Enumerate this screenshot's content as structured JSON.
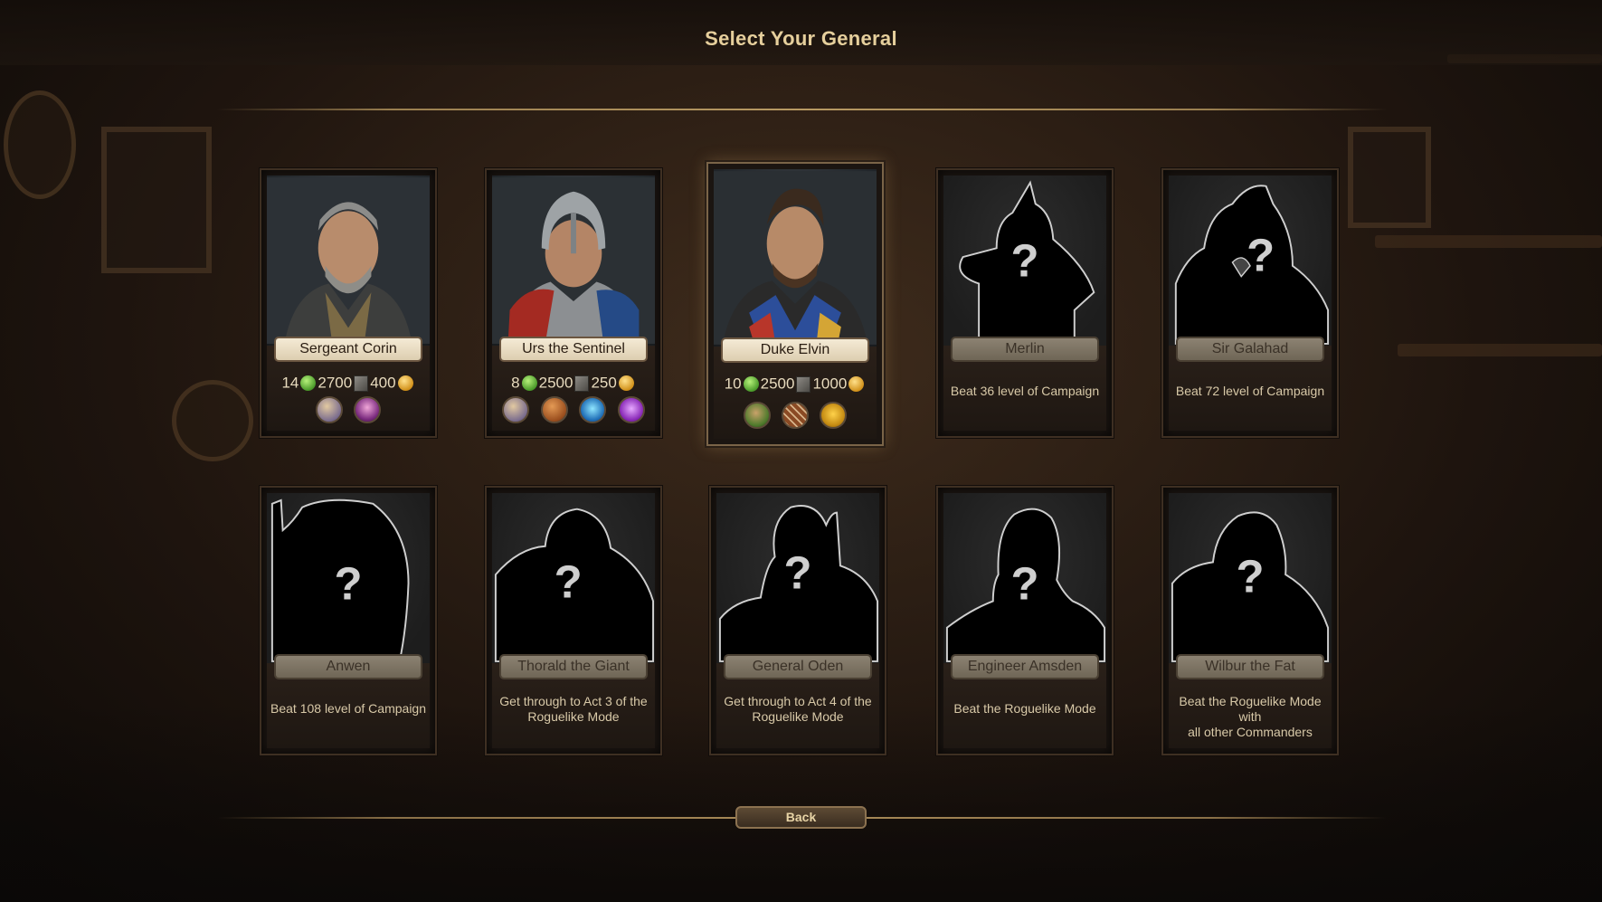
{
  "title": "Select Your General",
  "back_label": "Back",
  "colors": {
    "accent": "#b89a63",
    "title": "#e6cf9c",
    "card_bg": "#1b1511"
  },
  "generals_unlocked": [
    {
      "name": "Sergeant Corin",
      "stat1": "14",
      "stat2": "2700",
      "stat3": "400",
      "abilities": [
        "feather-ability-icon",
        "flame-ability-icon"
      ]
    },
    {
      "name": "Urs the Sentinel",
      "stat1": "8",
      "stat2": "2500",
      "stat3": "250",
      "abilities": [
        "feather-ability-icon",
        "shield-ability-icon",
        "troops-ability-icon",
        "magic-ability-icon"
      ]
    },
    {
      "name": "Duke Elvin",
      "stat1": "10",
      "stat2": "2500",
      "stat3": "1000",
      "abilities": [
        "horse-ability-icon",
        "arrows-ability-icon",
        "army-ability-icon"
      ]
    }
  ],
  "generals_locked": [
    {
      "name": "Merlin",
      "requirement": "Beat 36 level of Campaign"
    },
    {
      "name": "Sir Galahad",
      "requirement": "Beat 72 level of Campaign"
    },
    {
      "name": "Anwen",
      "requirement": "Beat 108 level of Campaign"
    },
    {
      "name": "Thorald the Giant",
      "requirement_line1": "Get through to Act 3 of the",
      "requirement_line2": "Roguelike Mode"
    },
    {
      "name": "General Oden",
      "requirement_line1": "Get through to Act 4 of the",
      "requirement_line2": "Roguelike Mode"
    },
    {
      "name": "Engineer Amsden",
      "requirement": "Beat the Roguelike Mode"
    },
    {
      "name": "Wilbur the Fat",
      "requirement_line1": "Beat the Roguelike Mode with",
      "requirement_line2": "all other Commanders"
    }
  ]
}
